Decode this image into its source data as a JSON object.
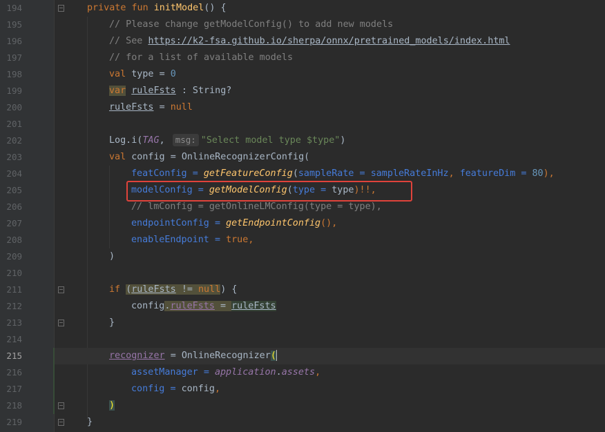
{
  "lines": [
    {
      "n": "194",
      "parts": [
        "private",
        "fun",
        "initModel",
        "() {"
      ]
    },
    {
      "n": "195",
      "text": "// Please change getModelConfig() to add new models"
    },
    {
      "n": "196",
      "text_prefix": "// See ",
      "link": "https://k2-fsa.github.io/sherpa/onnx/pretrained_models/index.html"
    },
    {
      "n": "197",
      "text": "// for a list of available models"
    },
    {
      "n": "198",
      "kw": "val",
      "name": "type",
      "eq": "=",
      "val": "0"
    },
    {
      "n": "199",
      "kw": "var",
      "name": "ruleFsts",
      "type": ": String?"
    },
    {
      "n": "200",
      "name": "ruleFsts",
      "eq": "=",
      "val": "null"
    },
    {
      "n": "201"
    },
    {
      "n": "202",
      "call": "Log.i(",
      "tag": "TAG",
      "hint": "msg:",
      "str": "\"Select model type $type\"",
      "close": ")"
    },
    {
      "n": "203",
      "kw": "val",
      "name": "config",
      "eq": "=",
      "ctor": "OnlineRecognizerConfig("
    },
    {
      "n": "204",
      "p1": "featConfig",
      "eq": "=",
      "f": "getFeatureConfig",
      "a1": "sampleRate",
      "v1": "sampleRateInHz",
      "a2": "featureDim",
      "v2": "80"
    },
    {
      "n": "205",
      "p1": "modelConfig",
      "eq": "=",
      "f": "getModelConfig",
      "a1": "type",
      "v1": "type",
      "tail": ")!!,"
    },
    {
      "n": "206",
      "text": "// lmConfig = getOnlineLMConfig(type = type),"
    },
    {
      "n": "207",
      "p1": "endpointConfig",
      "eq": "=",
      "f": "getEndpointConfig",
      "tail": "(),"
    },
    {
      "n": "208",
      "p1": "enableEndpoint",
      "eq": "=",
      "val": "true",
      "comma": ","
    },
    {
      "n": "209",
      "text": ")"
    },
    {
      "n": "210"
    },
    {
      "n": "211",
      "kw": "if",
      "name": "ruleFsts",
      "op": "!=",
      "val": "null",
      "tail": ") {"
    },
    {
      "n": "212",
      "obj": "config",
      "dot": ".",
      "field": "ruleFsts",
      "eq": "=",
      "name": "ruleFsts"
    },
    {
      "n": "213",
      "text": "}"
    },
    {
      "n": "214"
    },
    {
      "n": "215",
      "name": "recognizer",
      "eq": "=",
      "ctor": "OnlineRecognizer",
      "paren": "("
    },
    {
      "n": "216",
      "p1": "assetManager",
      "eq": "=",
      "obj": "application",
      "field": "assets",
      "comma": ","
    },
    {
      "n": "217",
      "p1": "config",
      "eq": "=",
      "name": "config",
      "comma": ","
    },
    {
      "n": "218",
      "paren": ")"
    },
    {
      "n": "219",
      "text": "}"
    }
  ],
  "colors": {
    "background": "#2b2b2b",
    "keyword": "#cc7832",
    "function": "#ffc66d",
    "comment": "#808080",
    "number": "#6897bb",
    "string": "#6a8759",
    "highlight_box": "#e0433b"
  }
}
